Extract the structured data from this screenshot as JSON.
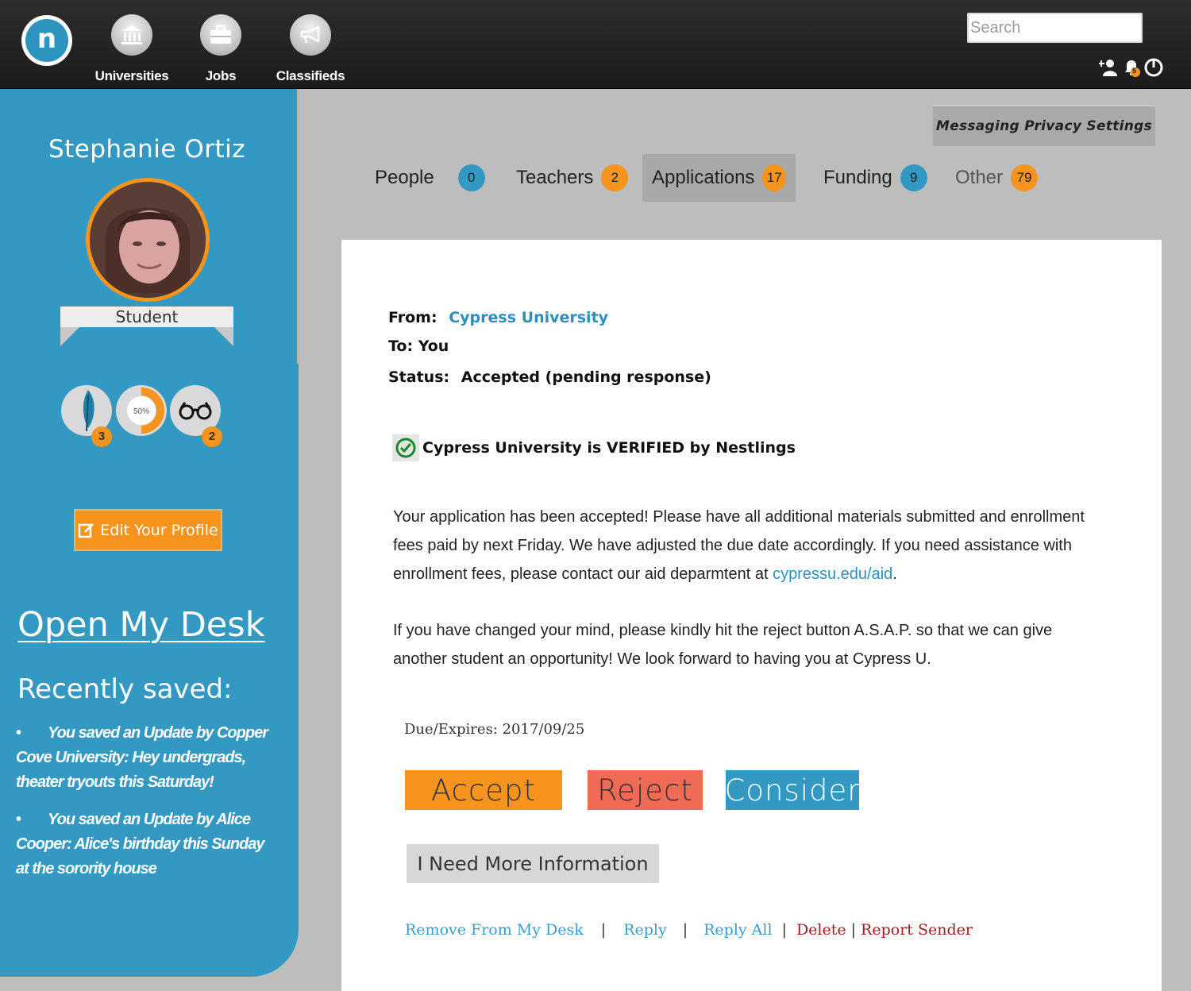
{
  "nav": {
    "logo_letter": "n",
    "items": [
      {
        "label": "Universities",
        "icon": "university-icon"
      },
      {
        "label": "Jobs",
        "icon": "briefcase-icon"
      },
      {
        "label": "Classifieds",
        "icon": "megaphone-icon"
      }
    ],
    "search_placeholder": "Search",
    "notification_count": "5"
  },
  "sidebar": {
    "user_name": "Stephanie Ortiz",
    "role": "Student",
    "badges": [
      {
        "icon": "feather-icon",
        "count": "3"
      },
      {
        "icon": "progress-ring-icon",
        "label": "50%",
        "progress": 0.5
      },
      {
        "icon": "glasses-icon",
        "count": "2"
      }
    ],
    "edit_profile_label": "Edit Your Profile",
    "open_desk_label": "Open My Desk",
    "recently_saved_title": "Recently saved:",
    "recently_saved": [
      "You saved an Update by Copper Cove University: Hey undergrads, theater tryouts this Saturday!",
      "You saved an Update by Alice Cooper: Alice's birthday this Sunday at the sorority house"
    ]
  },
  "privacy_button": "Messaging Privacy Settings",
  "tabs": [
    {
      "label": "People",
      "count": "0",
      "color": "#3399c3"
    },
    {
      "label": "Teachers",
      "count": "2",
      "color": "#f7941d"
    },
    {
      "label": "Applications",
      "count": "17",
      "color": "#f7941d",
      "active": true
    },
    {
      "label": "Funding",
      "count": "9",
      "color": "#3399c3"
    },
    {
      "label": "Other",
      "count": "79",
      "color": "#f7941d"
    }
  ],
  "message": {
    "from_label": "From:",
    "from_value": "Cypress University",
    "to_label": "To:",
    "to_value": "You",
    "status_label": "Status:",
    "status_value": "Accepted (pending response)",
    "verified_text": "Cypress University is VERIFIED by Nestlings",
    "paragraph1": "Your application has been accepted!  Please have all additional materials submitted and enrollment fees paid by next Friday.  We have adjusted the due date accordingly.  If  you need assistance with enrollment fees, please contact our aid deparmtent at ",
    "paragraph1_link": "cypressu.edu/aid",
    "paragraph1_end": ".",
    "paragraph2": "If you have changed your mind, please kindly hit the reject button A.S.A.P. so that we can give another student an opportunity!  We look forward to having you at Cypress U.",
    "due_label": "Due/Expires: 2017/09/25"
  },
  "actions": {
    "accept": "Accept",
    "reject": "Reject",
    "consider": "Consider",
    "more_info": "I Need More Information"
  },
  "footer_links": {
    "remove": "Remove From My Desk",
    "reply": "Reply",
    "reply_all": "Reply All",
    "delete": "Delete",
    "report": "Report Sender",
    "separator": "|"
  },
  "colors": {
    "accent_blue": "#3399c3",
    "accent_orange": "#f7941d",
    "reject_red": "#ef6b55",
    "link_blue": "#2e8fbf",
    "danger_link": "#9b1d1d"
  }
}
